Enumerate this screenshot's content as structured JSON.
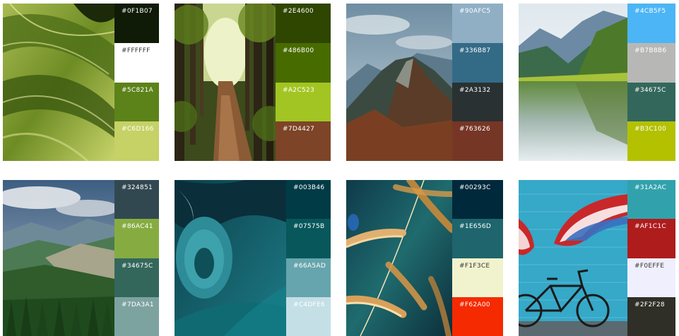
{
  "palettes": [
    {
      "scene": "leaf",
      "colors": [
        {
          "hex": "#0F1B07",
          "text_color": "#ffffff"
        },
        {
          "hex": "#FFFFFF",
          "text_color": "#333333"
        },
        {
          "hex": "#5C821A",
          "text_color": "#ffffff"
        },
        {
          "hex": "#C6D166",
          "text_color": "#ffffff"
        }
      ]
    },
    {
      "scene": "forest-path",
      "colors": [
        {
          "hex": "#2E4600",
          "text_color": "#ffffff"
        },
        {
          "hex": "#486B00",
          "text_color": "#ffffff"
        },
        {
          "hex": "#A2C523",
          "text_color": "#ffffff"
        },
        {
          "hex": "#7D4427",
          "text_color": "#ffffff"
        }
      ]
    },
    {
      "scene": "mountain-peak",
      "colors": [
        {
          "hex": "#90AFC5",
          "text_color": "#ffffff"
        },
        {
          "hex": "#336B87",
          "text_color": "#ffffff"
        },
        {
          "hex": "#2A3132",
          "text_color": "#ffffff"
        },
        {
          "hex": "#763626",
          "text_color": "#ffffff"
        }
      ]
    },
    {
      "scene": "mountain-lake",
      "colors": [
        {
          "hex": "#4CB5F5",
          "text_color": "#ffffff"
        },
        {
          "hex": "#B7B8B6",
          "text_color": "#ffffff"
        },
        {
          "hex": "#34675C",
          "text_color": "#ffffff"
        },
        {
          "hex": "#B3C100",
          "text_color": "#ffffff"
        }
      ]
    },
    {
      "scene": "valley",
      "colors": [
        {
          "hex": "#324851",
          "text_color": "#ffffff"
        },
        {
          "hex": "#86AC41",
          "text_color": "#ffffff"
        },
        {
          "hex": "#34675C",
          "text_color": "#ffffff"
        },
        {
          "hex": "#7DA3A1",
          "text_color": "#ffffff"
        }
      ]
    },
    {
      "scene": "wave",
      "colors": [
        {
          "hex": "#003B46",
          "text_color": "#ffffff"
        },
        {
          "hex": "#07575B",
          "text_color": "#ffffff"
        },
        {
          "hex": "#66A5AD",
          "text_color": "#ffffff"
        },
        {
          "hex": "#C4DFE6",
          "text_color": "#ffffff"
        }
      ]
    },
    {
      "scene": "grass",
      "colors": [
        {
          "hex": "#00293C",
          "text_color": "#ffffff"
        },
        {
          "hex": "#1E656D",
          "text_color": "#ffffff"
        },
        {
          "hex": "#F1F3CE",
          "text_color": "#333333"
        },
        {
          "hex": "#F62A00",
          "text_color": "#ffffff"
        }
      ]
    },
    {
      "scene": "wings-bicycle",
      "colors": [
        {
          "hex": "#31A2AC",
          "text_color": "#ffffff"
        },
        {
          "hex": "#AF1C1C",
          "text_color": "#ffffff"
        },
        {
          "hex": "#F0EFFE",
          "text_color": "#333333"
        },
        {
          "hex": "#2F2F28",
          "text_color": "#ffffff"
        }
      ]
    }
  ]
}
